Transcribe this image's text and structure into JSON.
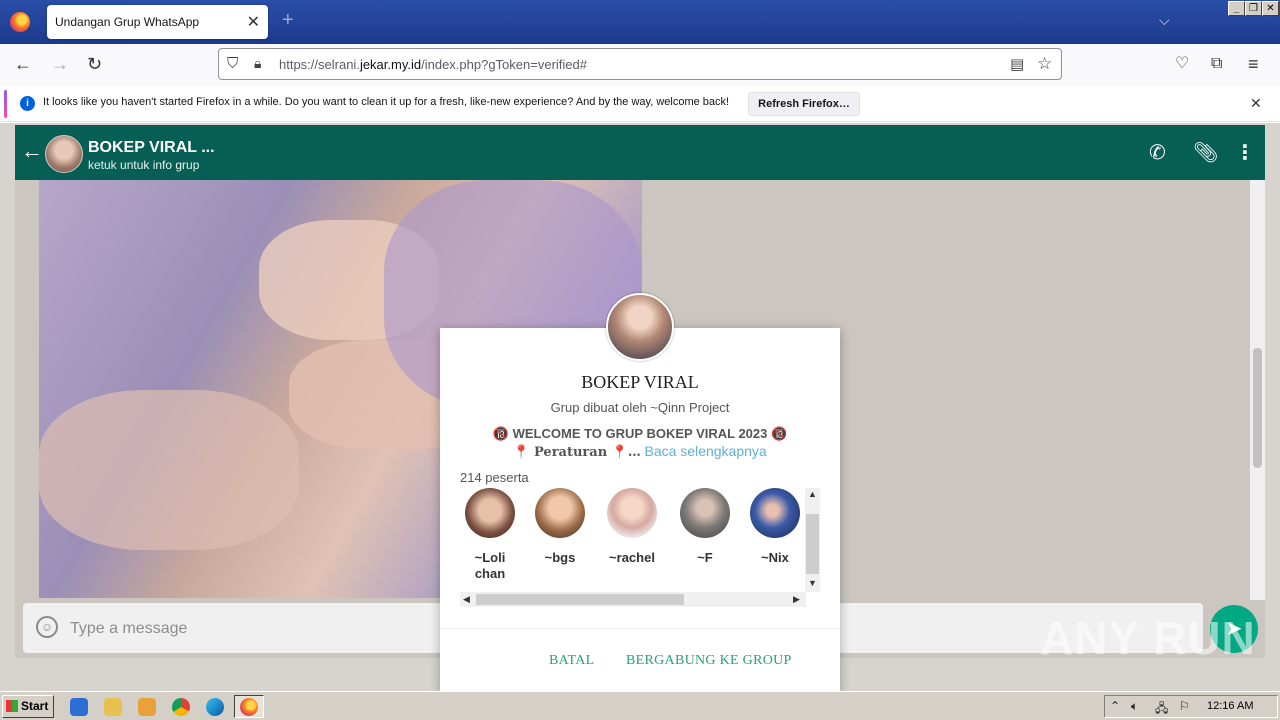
{
  "browser": {
    "tab_title": "Undangan Grup WhatsApp",
    "url_prefix": "https://selrani.",
    "url_domain": "jekar.my.id",
    "url_suffix": "/index.php?gToken=verified#",
    "notification_text": "It looks like you haven't started Firefox in a while. Do you want to clean it up for a fresh, like-new experience? And by the way, welcome back!",
    "notification_button": "Refresh Firefox…"
  },
  "chat": {
    "group_name": "BOKEP VIRAL ...",
    "subtitle": "ketuk untuk info grup",
    "message_placeholder": "Type a message"
  },
  "modal": {
    "title": "BOKEP VIRAL",
    "creator": "Grup dibuat oleh ~Qinn Project",
    "description_line1": "🔞 WELCOME TO GRUP BOKEP VIRAL 2023 🔞",
    "rules_label": "📍 Peraturan 📍…",
    "read_more": "Baca selengkapnya",
    "participants": "214 peserta",
    "members": [
      {
        "name": "~Loli chan"
      },
      {
        "name": "~bgs"
      },
      {
        "name": "~rachel"
      },
      {
        "name": "~F"
      },
      {
        "name": "~Nix"
      }
    ],
    "cancel_label": "BATAL",
    "join_label": "BERGABUNG KE GROUP"
  },
  "watermark": "ANY RUN",
  "taskbar": {
    "start_label": "Start",
    "clock": "12:16 AM"
  },
  "colors": {
    "whatsapp_header": "#075e54",
    "join_button": "#2aa178",
    "read_more": "#5fb0d9"
  }
}
